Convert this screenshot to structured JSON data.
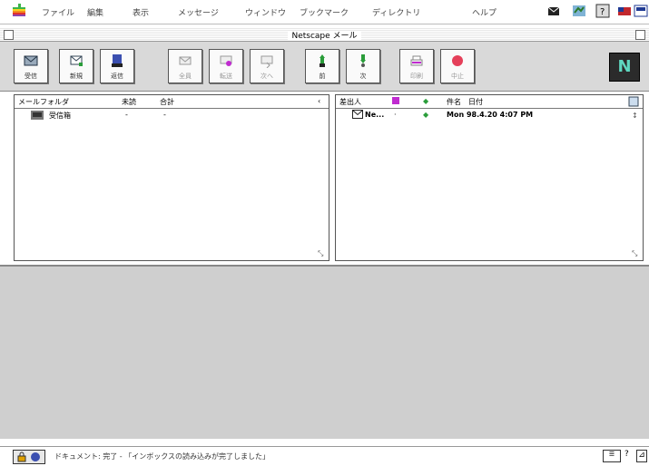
{
  "menubar": {
    "items": [
      "ファイル",
      "編集",
      "表示",
      "メッセージ",
      "ウィンドウ",
      "ブックマーク",
      "ディレクトリ",
      "ヘルプ"
    ]
  },
  "window": {
    "title": "Netscape メール"
  },
  "toolbar": {
    "buttons": [
      {
        "label": "受信",
        "icon": "get-mail-icon",
        "enabled": true
      },
      {
        "label": "新規",
        "icon": "new-message-icon",
        "enabled": true
      },
      {
        "label": "返信",
        "icon": "reply-icon",
        "enabled": true
      },
      {
        "label": "全員",
        "icon": "reply-all-icon",
        "enabled": false
      },
      {
        "label": "転送",
        "icon": "forward-icon",
        "enabled": false
      },
      {
        "label": "次へ",
        "icon": "next-icon",
        "enabled": false
      },
      {
        "label": "前",
        "icon": "previous-icon",
        "enabled": true
      },
      {
        "label": "次",
        "icon": "next-message-icon",
        "enabled": true
      },
      {
        "label": "印刷",
        "icon": "print-icon",
        "enabled": false
      },
      {
        "label": "中止",
        "icon": "stop-icon",
        "enabled": false
      }
    ],
    "logo": "N"
  },
  "folders": {
    "columns": [
      "メールフォルダ",
      "未読",
      "合計"
    ],
    "rows": [
      {
        "name": "受信箱",
        "unread": "-",
        "total": "-"
      }
    ]
  },
  "messages": {
    "columns": [
      "差出人",
      "",
      "",
      "件名",
      "日付"
    ],
    "rows": [
      {
        "sender": "Ne...",
        "date": "Mon 98.4.20 4:07 PM"
      }
    ]
  },
  "status": {
    "text": "ドキュメント: 完了 - 「インボックスの読み込みが完了しました」"
  },
  "colors": {
    "accent": "#2a9d3a",
    "unread_marker": "#2a9d3a",
    "flag": "#c02bd0"
  }
}
